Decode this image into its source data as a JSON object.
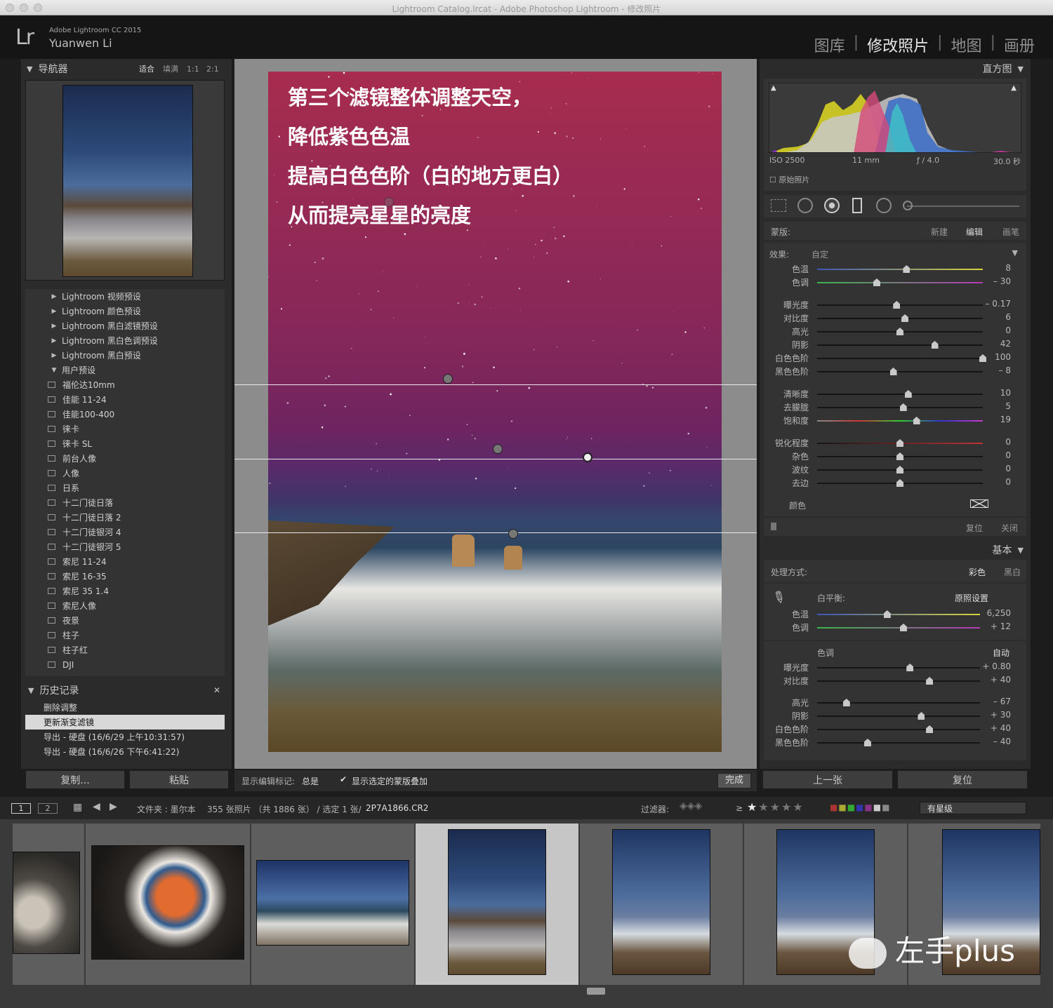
{
  "window": {
    "title": "Lightroom Catalog.lrcat - Adobe Photoshop Lightroom - 修改照片"
  },
  "identity": {
    "logo": "Lr",
    "brand": "Adobe Lightroom CC 2015",
    "user": "Yuanwen Li"
  },
  "modules": [
    "图库",
    "修改照片",
    "地图",
    "画册"
  ],
  "modules_active": "修改照片",
  "navigator": {
    "title": "导航器",
    "zoom": [
      "适合",
      "填满",
      "1:1",
      "2:1"
    ]
  },
  "presets": {
    "groups": [
      "Lightroom 视频预设",
      "Lightroom 颜色预设",
      "Lightroom 黑白滤镜预设",
      "Lightroom 黑白色调预设",
      "Lightroom 黑白预设"
    ],
    "user_folder": "用户预设",
    "items": [
      "福伦达10mm",
      "佳能 11-24",
      "佳能100-400",
      "徕卡",
      "徕卡 SL",
      "前台人像",
      "人像",
      "日系",
      "十二门徒日落",
      "十二门徒日落 2",
      "十二门徒银河 4",
      "十二门徒银河 5",
      "索尼 11-24",
      "索尼 16-35",
      "索尼 35 1.4",
      "索尼人像",
      "夜景",
      "柱子",
      "柱子红",
      "DJI"
    ]
  },
  "history": {
    "title": "历史记录",
    "close": "✕",
    "items": [
      "删除调整",
      "更新渐变滤镜",
      "导出 - 硬盘 (16/6/29 上午10:31:57)",
      "导出 - 硬盘 (16/6/26 下午6:41:22)"
    ],
    "selected": 1
  },
  "left_buttons": {
    "copy": "复制...",
    "paste": "粘贴"
  },
  "annotation": [
    "第三个滤镜整体调整天空，",
    "降低紫色色温",
    "提高白色色阶（白的地方更白）",
    "从而提亮星星的亮度"
  ],
  "toolbar": {
    "show_label": "显示编辑标记:",
    "show_value": "总是",
    "checkbox_label": "显示选定的蒙版叠加",
    "checked": true,
    "done": "完成"
  },
  "histogram": {
    "title": "直方图",
    "iso": "ISO 2500",
    "focal": "11 mm",
    "aperture": "ƒ / 4.0",
    "shutter": "30.0 秒",
    "original": "原始照片"
  },
  "mask": {
    "label": "蒙版:",
    "new": "新建",
    "edit": "编辑",
    "brush": "画笔"
  },
  "effect": {
    "label": "效果:",
    "value": "自定"
  },
  "mask_sliders": [
    {
      "label": "色温",
      "value": "8",
      "pos": 0.54,
      "kind": "temp"
    },
    {
      "label": "色调",
      "value": "– 30",
      "pos": 0.36,
      "kind": "tint"
    },
    {
      "label": "曝光度",
      "value": "– 0.17",
      "pos": 0.48,
      "kind": "gray"
    },
    {
      "label": "对比度",
      "value": "6",
      "pos": 0.53,
      "kind": "gray"
    },
    {
      "label": "高光",
      "value": "0",
      "pos": 0.5,
      "kind": "gray"
    },
    {
      "label": "阴影",
      "value": "42",
      "pos": 0.71,
      "kind": "gray"
    },
    {
      "label": "白色色阶",
      "value": "100",
      "pos": 1.0,
      "kind": "gray"
    },
    {
      "label": "黑色色阶",
      "value": "– 8",
      "pos": 0.46,
      "kind": "gray"
    },
    {
      "label": "清晰度",
      "value": "10",
      "pos": 0.55,
      "kind": "gray"
    },
    {
      "label": "去朦胧",
      "value": "5",
      "pos": 0.52,
      "kind": "gray"
    },
    {
      "label": "饱和度",
      "value": "19",
      "pos": 0.6,
      "kind": "sat"
    },
    {
      "label": "锐化程度",
      "value": "0",
      "pos": 0.5,
      "kind": "red"
    },
    {
      "label": "杂色",
      "value": "0",
      "pos": 0.5,
      "kind": "gray"
    },
    {
      "label": "波纹",
      "value": "0",
      "pos": 0.5,
      "kind": "gray"
    },
    {
      "label": "去边",
      "value": "0",
      "pos": 0.5,
      "kind": "gray"
    }
  ],
  "mask_color": "颜色",
  "mask_footer": {
    "reset": "复位",
    "close": "关闭"
  },
  "basic": {
    "title": "基本",
    "treatment": "处理方式:",
    "color": "彩色",
    "bw": "黑白",
    "wb_label": "白平衡:",
    "wb_value": "原照设置",
    "tone": "色调",
    "auto": "自动"
  },
  "basic_sliders": [
    {
      "label": "色温",
      "value": "6,250",
      "pos": 0.43,
      "kind": "temp"
    },
    {
      "label": "色调",
      "value": "+ 12",
      "pos": 0.53,
      "kind": "tint"
    },
    {
      "label": "曝光度",
      "value": "+ 0.80",
      "pos": 0.57,
      "kind": "gray"
    },
    {
      "label": "对比度",
      "value": "+ 40",
      "pos": 0.69,
      "kind": "gray"
    },
    {
      "label": "高光",
      "value": "– 67",
      "pos": 0.18,
      "kind": "gray"
    },
    {
      "label": "阴影",
      "value": "+ 30",
      "pos": 0.64,
      "kind": "gray"
    },
    {
      "label": "白色色阶",
      "value": "+ 40",
      "pos": 0.69,
      "kind": "gray"
    },
    {
      "label": "黑色色阶",
      "value": "– 40",
      "pos": 0.31,
      "kind": "gray"
    }
  ],
  "right_buttons": {
    "prev": "上一张",
    "reset": "复位"
  },
  "filmstrip_bar": {
    "page1": "1",
    "page2": "2",
    "source": "文件夹 : 墨尔本",
    "count": "355 张照片 （共 1886 张） / 选定 1 张/",
    "filename": "2P7A1866.CR2",
    "filter": "过滤器:",
    "rating_op": "≥",
    "rating_value": "有星级"
  },
  "watermark": "左手plus",
  "colors": {
    "accent_active": "#e6e6e6",
    "panel": "#2b2b2b",
    "center_bg": "#8c8c8c"
  }
}
